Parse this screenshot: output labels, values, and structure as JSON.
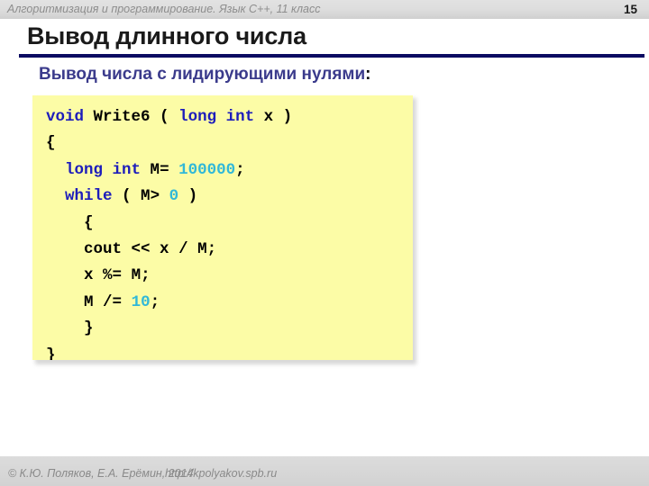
{
  "header": {
    "course": "Алгоритмизация и программирование. Язык C++, 11 класс",
    "page_number": "15"
  },
  "slide": {
    "title": "Вывод длинного числа",
    "subtitle_text": "Вывод числа с лидирующими нулями",
    "subtitle_colon": ":",
    "rule_color": "#0b0b62",
    "subtitle_color": "#3b3b8c"
  },
  "code": {
    "background": "#fcfca6",
    "keyword_color": "#1d1dbb",
    "number_color": "#31b8d8",
    "plain_color": "#000000",
    "language": "C++",
    "full_text": "void Write6 ( long int x )\n{\n  long int M = 100000;\n  while ( M > 0 )\n    {\n    cout << x / M;\n    x %= M;\n    M /= 10;\n    }\n}",
    "lines": [
      {
        "indent": "",
        "tokens": [
          {
            "t": "void",
            "c": "kw"
          },
          {
            "t": " ",
            "c": "pl"
          },
          {
            "t": "Write6",
            "c": "pl"
          },
          {
            "t": " ( ",
            "c": "pl"
          },
          {
            "t": "long int",
            "c": "kw"
          },
          {
            "t": " ",
            "c": "pl"
          },
          {
            "t": "x )",
            "c": "pl"
          }
        ]
      },
      {
        "indent": "",
        "tokens": [
          {
            "t": "{",
            "c": "pl"
          }
        ]
      },
      {
        "indent": "  ",
        "tokens": [
          {
            "t": "long int",
            "c": "kw"
          },
          {
            "t": " ",
            "c": "pl"
          },
          {
            "t": "M",
            "c": "pl"
          },
          {
            "t": "= ",
            "c": "pl"
          },
          {
            "t": "100000",
            "c": "num"
          },
          {
            "t": ";",
            "c": "pl"
          }
        ]
      },
      {
        "indent": "  ",
        "tokens": [
          {
            "t": "while",
            "c": "kw"
          },
          {
            "t": " ( ",
            "c": "pl"
          },
          {
            "t": "M",
            "c": "pl"
          },
          {
            "t": "> ",
            "c": "pl"
          },
          {
            "t": "0",
            "c": "num"
          },
          {
            "t": " )",
            "c": "pl"
          }
        ]
      },
      {
        "indent": "    ",
        "tokens": [
          {
            "t": "{",
            "c": "pl"
          }
        ]
      },
      {
        "indent": "    ",
        "tokens": [
          {
            "t": "cout",
            "c": "pl"
          },
          {
            "t": " << ",
            "c": "pl"
          },
          {
            "t": "x",
            "c": "pl"
          },
          {
            "t": " / ",
            "c": "pl"
          },
          {
            "t": "M;",
            "c": "pl"
          }
        ]
      },
      {
        "indent": "    ",
        "tokens": [
          {
            "t": "x",
            "c": "pl"
          },
          {
            "t": " %",
            "c": "pl"
          },
          {
            "t": "= ",
            "c": "pl"
          },
          {
            "t": "M;",
            "c": "pl"
          }
        ]
      },
      {
        "indent": "    ",
        "tokens": [
          {
            "t": "M",
            "c": "pl"
          },
          {
            "t": " /",
            "c": "pl"
          },
          {
            "t": "= ",
            "c": "pl"
          },
          {
            "t": "10",
            "c": "num"
          },
          {
            "t": ";",
            "c": "pl"
          }
        ]
      },
      {
        "indent": "    ",
        "tokens": [
          {
            "t": "}",
            "c": "pl"
          }
        ]
      },
      {
        "indent": "",
        "tokens": [
          {
            "t": "}",
            "c": "pl"
          }
        ]
      }
    ]
  },
  "footer": {
    "copyright": "© К.Ю. Поляков, Е.А. Ерёмин, 2014",
    "url": "http://kpolyakov.spb.ru"
  }
}
